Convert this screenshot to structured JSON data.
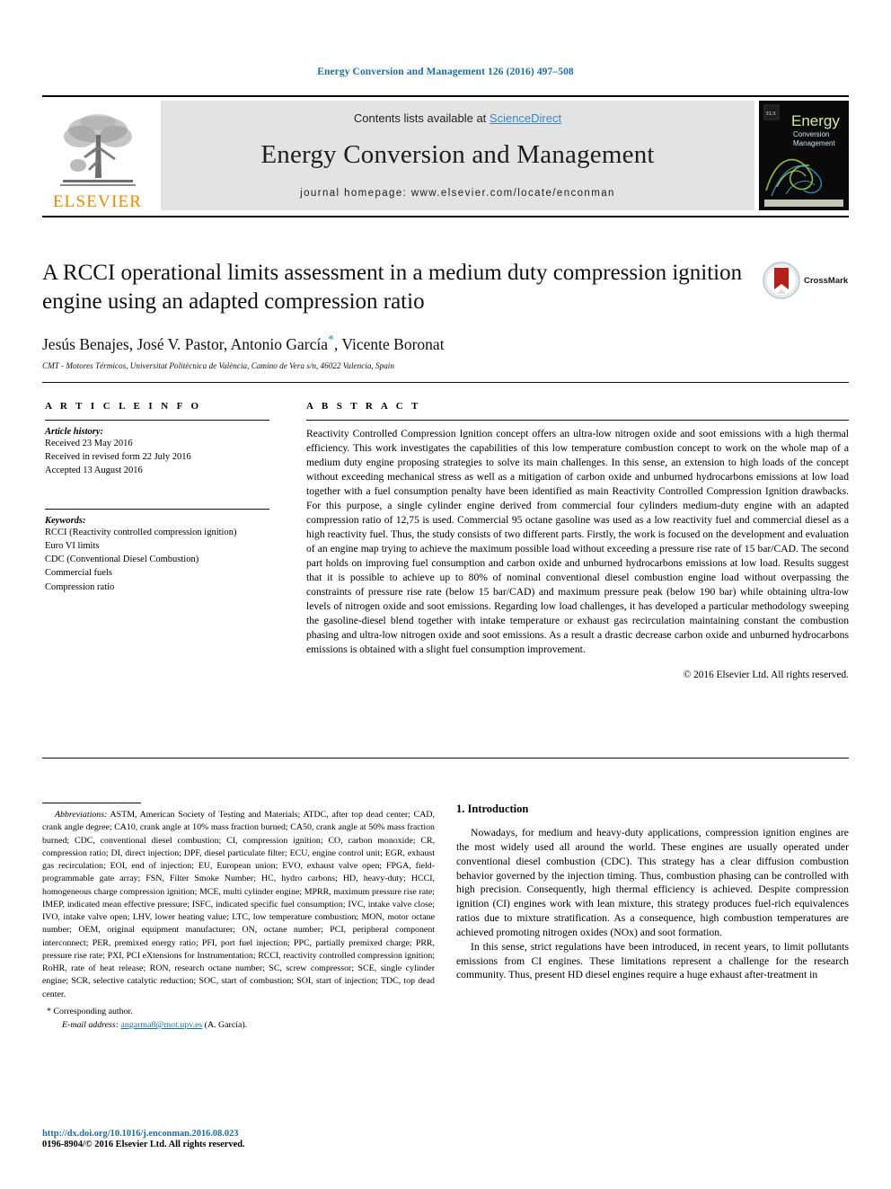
{
  "running_head": "Energy Conversion and Management 126 (2016) 497–508",
  "masthead": {
    "contents_prefix": "Contents lists available at ",
    "sciencedirect": "ScienceDirect",
    "journal_title": "Energy Conversion and Management",
    "homepage": "journal homepage: www.elsevier.com/locate/enconman",
    "publisher_logo_text": "ELSEVIER",
    "cover_title_line1": "Energy",
    "cover_title_line2": "Conversion",
    "cover_title_line3": "Management",
    "link_color": "#3a8ac0",
    "elsevier_orange": "#ED8B00"
  },
  "article": {
    "title": "A RCCI operational limits assessment in a medium duty compression ignition engine using an adapted compression ratio",
    "authors_pre": "Jesús Benajes, José V. Pastor, Antonio García",
    "authors_post": ", Vicente Boronat",
    "corresponding_marker": "*",
    "affiliation": "CMT - Motores Térmicos, Universitat Politècnica de València, Camino de Vera s/n, 46022 Valencia, Spain",
    "crossmark_label": "CrossMark"
  },
  "article_info": {
    "heading": "A R T I C L E   I N F O",
    "history_label": "Article history:",
    "history": [
      "Received 23 May 2016",
      "Received in revised form 22 July 2016",
      "Accepted 13 August 2016"
    ],
    "keywords_label": "Keywords:",
    "keywords": [
      "RCCI (Reactivity controlled compression ignition)",
      "Euro VI limits",
      "CDC (Conventional Diesel Combustion)",
      "Commercial fuels",
      "Compression ratio"
    ]
  },
  "abstract": {
    "heading": "A B S T R A C T",
    "text": "Reactivity Controlled Compression Ignition concept offers an ultra-low nitrogen oxide and soot emissions with a high thermal efficiency. This work investigates the capabilities of this low temperature combustion concept to work on the whole map of a medium duty engine proposing strategies to solve its main challenges. In this sense, an extension to high loads of the concept without exceeding mechanical stress as well as a mitigation of carbon oxide and unburned hydrocarbons emissions at low load together with a fuel consumption penalty have been identified as main Reactivity Controlled Compression Ignition drawbacks. For this purpose, a single cylinder engine derived from commercial four cylinders medium-duty engine with an adapted compression ratio of 12,75 is used. Commercial 95 octane gasoline was used as a low reactivity fuel and commercial diesel as a high reactivity fuel. Thus, the study consists of two different parts. Firstly, the work is focused on the development and evaluation of an engine map trying to achieve the maximum possible load without exceeding a pressure rise rate of 15 bar/CAD. The second part holds on improving fuel consumption and carbon oxide and unburned hydrocarbons emissions at low load. Results suggest that it is possible to achieve up to 80% of nominal conventional diesel combustion engine load without overpassing the constraints of pressure rise rate (below 15 bar/CAD) and maximum pressure peak (below 190 bar) while obtaining ultra-low levels of nitrogen oxide and soot emissions. Regarding low load challenges, it has developed a particular methodology sweeping the gasoline-diesel blend together with intake temperature or exhaust gas recirculation maintaining constant the combustion phasing and ultra-low nitrogen oxide and soot emissions. As a result a drastic decrease carbon oxide and unburned hydrocarbons emissions is obtained with a slight fuel consumption improvement.",
    "copyright": "© 2016 Elsevier Ltd. All rights reserved."
  },
  "footnotes": {
    "abbrev_label": "Abbreviations:",
    "abbrev_text": "ASTM, American Society of Testing and Materials; ATDC, after top dead center; CAD, crank angle degree; CA10, crank angle at 10% mass fraction burned; CA50, crank angle at 50% mass fraction burned; CDC, conventional diesel combustion; CI, compression ignition; CO, carbon monoxide; CR, compression ratio; DI, direct injection; DPF, diesel particulate filter; ECU, engine control unit; EGR, exhaust gas recirculation; EOI, end of injection; EU, European union; EVO, exhaust valve open; FPGA, field-programmable gate array; FSN, Filter Smoke Number; HC, hydro carbons; HD, heavy-duty; HCCI, homogeneous charge compression ignition; MCE, multi cylinder engine; MPRR, maximum pressure rise rate; IMEP, indicated mean effective pressure; ISFC, indicated specific fuel consumption; IVC, intake valve close; IVO, intake valve open; LHV, lower heating value; LTC, low temperature combustion; MON, motor octane number; OEM, original equipment manufacturer; ON, octane number; PCI, peripheral component interconnect; PER, premixed energy ratio; PFI, port fuel injection; PPC, partially premixed charge; PRR, pressure rise rate; PXI, PCI eXtensions for Instrumentation; RCCI, reactivity controlled compression ignition; RoHR, rate of heat release; RON, research octane number; SC, screw compressor; SCE, single cylinder engine; SCR, selective catalytic reduction; SOC, start of combustion; SOI, start of injection; TDC, top dead center.",
    "corresponding_marker": "*",
    "corresponding_text": "Corresponding author.",
    "email_label": "E-mail address:",
    "email": "angarma8@mot.upv.es",
    "email_suffix": " (A. García)."
  },
  "footer": {
    "doi": "http://dx.doi.org/10.1016/j.enconman.2016.08.023",
    "issn": "0196-8904/© 2016 Elsevier Ltd. All rights reserved."
  },
  "introduction": {
    "heading": "1. Introduction",
    "paragraph1": "Nowadays, for medium and heavy-duty applications, compression ignition engines are the most widely used all around the world. These engines are usually operated under conventional diesel combustion (CDC). This strategy has a clear diffusion combustion behavior governed by the injection timing. Thus, combustion phasing can be controlled with high precision. Consequently, high thermal efficiency is achieved. Despite compression ignition (CI) engines work with lean mixture, this strategy produces fuel-rich equivalences ratios due to mixture stratification. As a consequence, high combustion temperatures are achieved promoting nitrogen oxides (NOx) and soot formation.",
    "paragraph2": "In this sense, strict regulations have been introduced, in recent years, to limit pollutants emissions from CI engines. These limitations represent a challenge for the research community. Thus, present HD diesel engines require a huge exhaust after-treatment in"
  }
}
